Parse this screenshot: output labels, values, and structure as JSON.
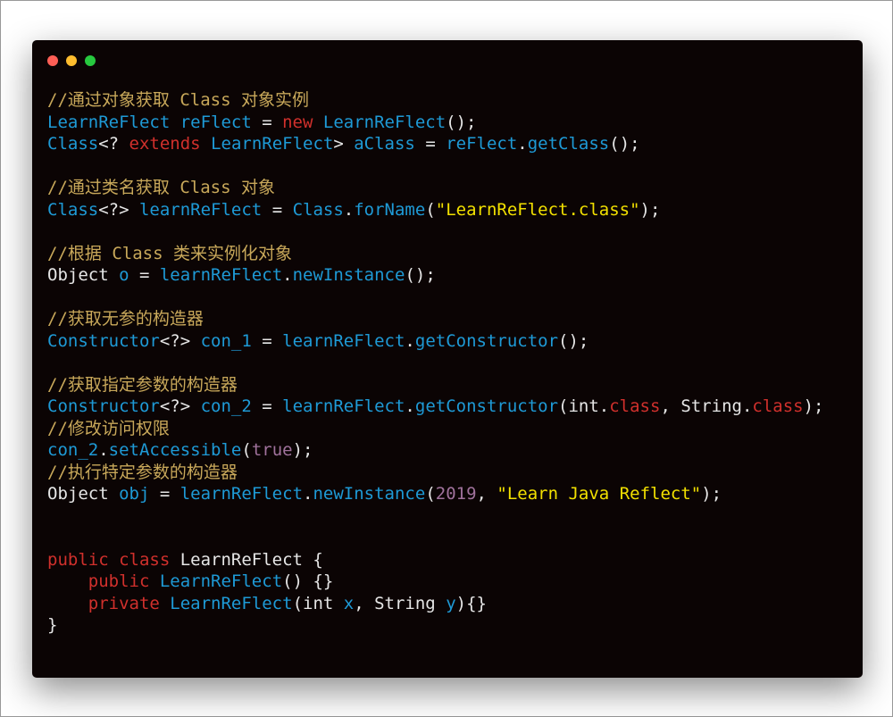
{
  "window": {
    "controls": [
      {
        "name": "close",
        "color": "#ff5f56"
      },
      {
        "name": "minimize",
        "color": "#ffbd2e"
      },
      {
        "name": "maximize",
        "color": "#27c93f"
      }
    ]
  },
  "code": {
    "lines": [
      [
        [
          "c",
          "//通过对象获取 Class 对象实例"
        ]
      ],
      [
        [
          "b",
          "LearnReFlect reFlect"
        ],
        [
          "w",
          " = "
        ],
        [
          "r",
          "new"
        ],
        [
          "w",
          " "
        ],
        [
          "b",
          "LearnReFlect"
        ],
        [
          "w",
          "();"
        ]
      ],
      [
        [
          "b",
          "Class"
        ],
        [
          "w",
          "<? "
        ],
        [
          "r",
          "extends"
        ],
        [
          "w",
          " "
        ],
        [
          "b",
          "LearnReFlect"
        ],
        [
          "w",
          "> "
        ],
        [
          "b",
          "aClass"
        ],
        [
          "w",
          " = "
        ],
        [
          "b",
          "reFlect"
        ],
        [
          "w",
          "."
        ],
        [
          "b",
          "getClass"
        ],
        [
          "w",
          "();"
        ]
      ],
      [],
      [
        [
          "c",
          "//通过类名获取 Class 对象"
        ]
      ],
      [
        [
          "b",
          "Class"
        ],
        [
          "w",
          "<?> "
        ],
        [
          "b",
          "learnReFlect"
        ],
        [
          "w",
          " = "
        ],
        [
          "b",
          "Class"
        ],
        [
          "w",
          "."
        ],
        [
          "b",
          "forName"
        ],
        [
          "w",
          "("
        ],
        [
          "y",
          "\"LearnReFlect.class\""
        ],
        [
          "w",
          ");"
        ]
      ],
      [],
      [
        [
          "c",
          "//根据 Class 类来实例化对象"
        ]
      ],
      [
        [
          "w",
          "Object "
        ],
        [
          "b",
          "o"
        ],
        [
          "w",
          " = "
        ],
        [
          "b",
          "learnReFlect"
        ],
        [
          "w",
          "."
        ],
        [
          "b",
          "newInstance"
        ],
        [
          "w",
          "();"
        ]
      ],
      [],
      [
        [
          "c",
          "//获取无参的构造器"
        ]
      ],
      [
        [
          "b",
          "Constructor"
        ],
        [
          "w",
          "<?> "
        ],
        [
          "b",
          "con_1"
        ],
        [
          "w",
          " = "
        ],
        [
          "b",
          "learnReFlect"
        ],
        [
          "w",
          "."
        ],
        [
          "b",
          "getConstructor"
        ],
        [
          "w",
          "();"
        ]
      ],
      [],
      [
        [
          "c",
          "//获取指定参数的构造器"
        ]
      ],
      [
        [
          "b",
          "Constructor"
        ],
        [
          "w",
          "<?> "
        ],
        [
          "b",
          "con_2"
        ],
        [
          "w",
          " = "
        ],
        [
          "b",
          "learnReFlect"
        ],
        [
          "w",
          "."
        ],
        [
          "b",
          "getConstructor"
        ],
        [
          "w",
          "(int."
        ],
        [
          "r",
          "class"
        ],
        [
          "w",
          ", String."
        ],
        [
          "r",
          "class"
        ],
        [
          "w",
          ");"
        ]
      ],
      [
        [
          "c",
          "//修改访问权限"
        ]
      ],
      [
        [
          "b",
          "con_2"
        ],
        [
          "w",
          "."
        ],
        [
          "b",
          "setAccessible"
        ],
        [
          "w",
          "("
        ],
        [
          "p",
          "true"
        ],
        [
          "w",
          ");"
        ]
      ],
      [
        [
          "c",
          "//执行特定参数的构造器"
        ]
      ],
      [
        [
          "w",
          "Object "
        ],
        [
          "b",
          "obj"
        ],
        [
          "w",
          " = "
        ],
        [
          "b",
          "learnReFlect"
        ],
        [
          "w",
          "."
        ],
        [
          "b",
          "newInstance"
        ],
        [
          "w",
          "("
        ],
        [
          "p",
          "2019"
        ],
        [
          "w",
          ", "
        ],
        [
          "y",
          "\"Learn Java Reflect\""
        ],
        [
          "w",
          ");"
        ]
      ],
      [],
      [],
      [
        [
          "r",
          "public class"
        ],
        [
          "w",
          " LearnReFlect {"
        ]
      ],
      [
        [
          "w",
          "    "
        ],
        [
          "r",
          "public"
        ],
        [
          "w",
          " "
        ],
        [
          "b",
          "LearnReFlect"
        ],
        [
          "w",
          "() {}"
        ]
      ],
      [
        [
          "w",
          "    "
        ],
        [
          "r",
          "private"
        ],
        [
          "w",
          " "
        ],
        [
          "b",
          "LearnReFlect"
        ],
        [
          "w",
          "(int "
        ],
        [
          "b",
          "x"
        ],
        [
          "w",
          ", String "
        ],
        [
          "b",
          "y"
        ],
        [
          "w",
          "){}"
        ]
      ],
      [
        [
          "w",
          "}"
        ]
      ]
    ]
  }
}
